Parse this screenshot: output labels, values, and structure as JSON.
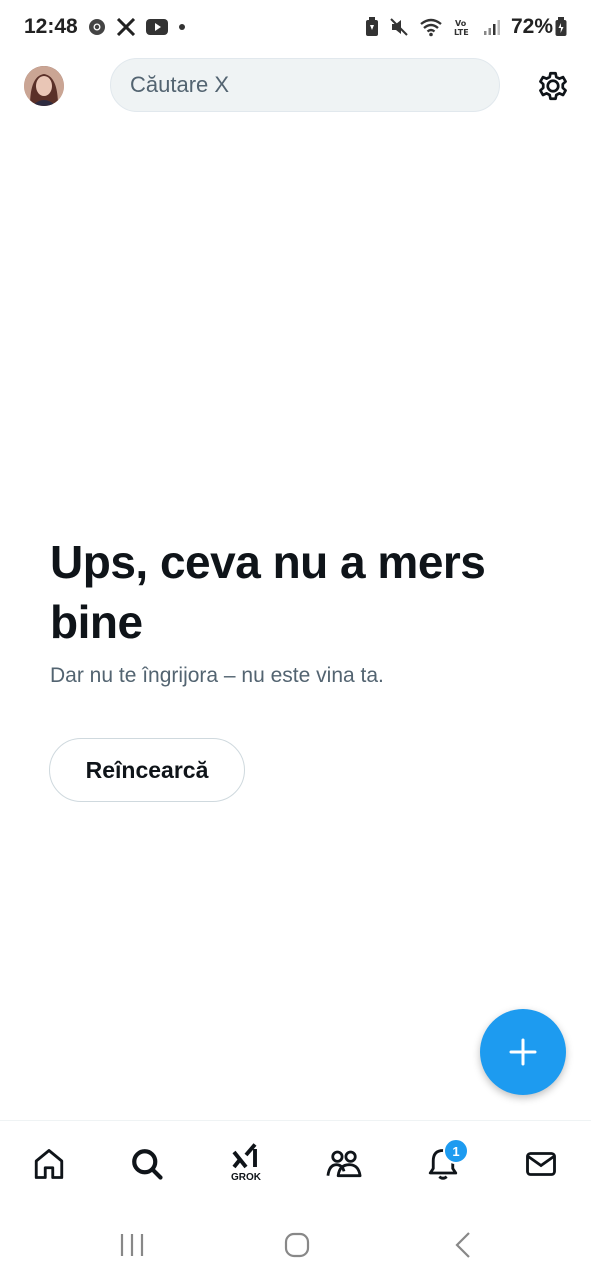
{
  "status_bar": {
    "time": "12:48",
    "battery": "72%",
    "left_icons": [
      "chrome-icon",
      "x-icon",
      "youtube-icon",
      "dot-icon"
    ],
    "right_icons": [
      "battery-saver-icon",
      "mute-icon",
      "wifi-icon",
      "volte-icon",
      "signal-icon",
      "battery-icon"
    ]
  },
  "header": {
    "search_placeholder": "Căutare X"
  },
  "error": {
    "title": "Ups, ceva nu a mers bine",
    "subtitle": "Dar nu te îngrijora – nu este vina ta.",
    "retry_label": "Reîncearcă"
  },
  "bottom_nav": {
    "items": [
      "home-icon",
      "search-icon",
      "grok-icon",
      "communities-icon",
      "notifications-icon",
      "messages-icon"
    ],
    "grok_label": "GROK",
    "notification_count": "1"
  },
  "colors": {
    "accent": "#1d9bf0",
    "text_primary": "#0f1419",
    "text_secondary": "#536471",
    "search_bg": "#eff3f4"
  }
}
